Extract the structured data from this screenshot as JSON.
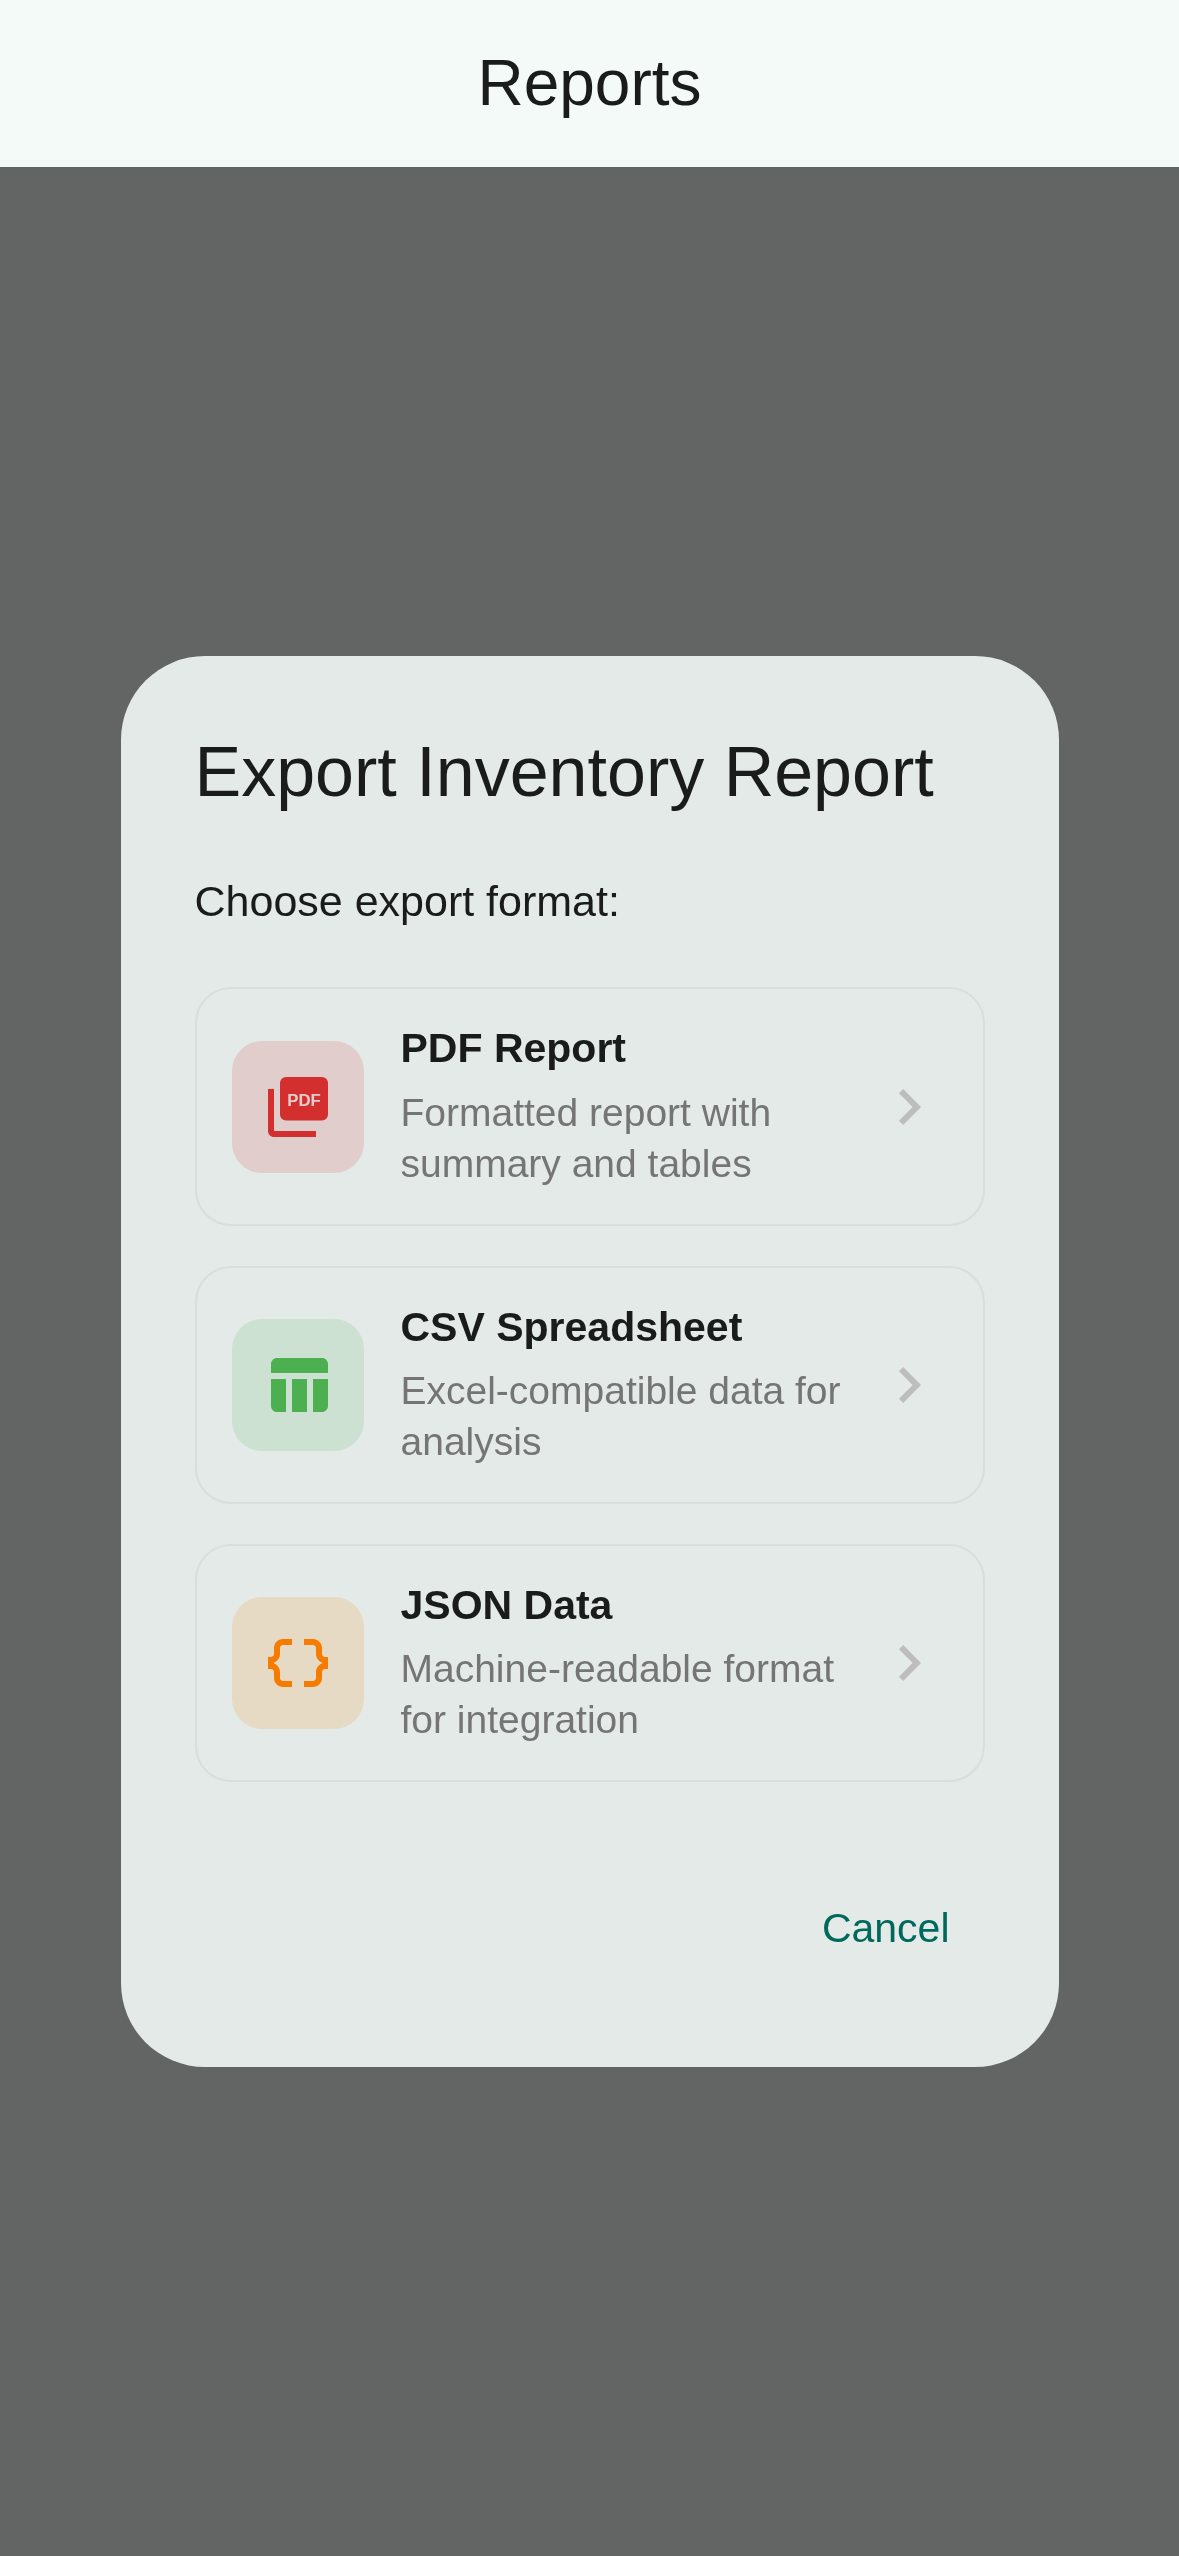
{
  "app_bar": {
    "title": "Reports"
  },
  "dialog": {
    "title": "Export Inventory Report",
    "message": "Choose export format:",
    "options": [
      {
        "kind": "pdf",
        "color": "#d32f2f",
        "icon_text": "PDF",
        "title": "PDF Report",
        "description": "Formatted report with summary and tables"
      },
      {
        "kind": "table",
        "color": "#4caf50",
        "title": "CSV Spreadsheet",
        "description": "Excel-compatible data for analysis"
      },
      {
        "kind": "braces",
        "color": "#f57c00",
        "title": "JSON Data",
        "description": "Machine-readable format for integration"
      }
    ],
    "buttons": [
      {
        "label": "Cancel"
      }
    ]
  }
}
